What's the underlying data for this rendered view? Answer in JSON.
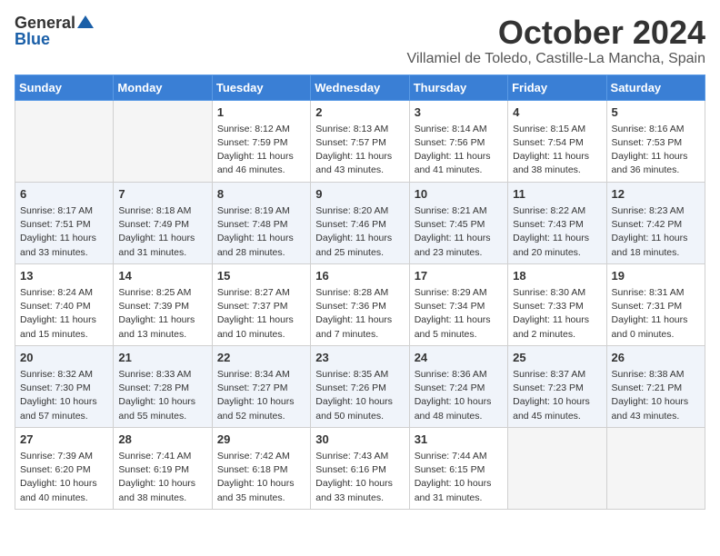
{
  "header": {
    "logo_general": "General",
    "logo_blue": "Blue",
    "month": "October 2024",
    "location": "Villamiel de Toledo, Castille-La Mancha, Spain"
  },
  "days_of_week": [
    "Sunday",
    "Monday",
    "Tuesday",
    "Wednesday",
    "Thursday",
    "Friday",
    "Saturday"
  ],
  "weeks": [
    [
      {
        "day": "",
        "sunrise": "",
        "sunset": "",
        "daylight": "",
        "empty": true
      },
      {
        "day": "",
        "sunrise": "",
        "sunset": "",
        "daylight": "",
        "empty": true
      },
      {
        "day": "1",
        "sunrise": "Sunrise: 8:12 AM",
        "sunset": "Sunset: 7:59 PM",
        "daylight": "Daylight: 11 hours and 46 minutes."
      },
      {
        "day": "2",
        "sunrise": "Sunrise: 8:13 AM",
        "sunset": "Sunset: 7:57 PM",
        "daylight": "Daylight: 11 hours and 43 minutes."
      },
      {
        "day": "3",
        "sunrise": "Sunrise: 8:14 AM",
        "sunset": "Sunset: 7:56 PM",
        "daylight": "Daylight: 11 hours and 41 minutes."
      },
      {
        "day": "4",
        "sunrise": "Sunrise: 8:15 AM",
        "sunset": "Sunset: 7:54 PM",
        "daylight": "Daylight: 11 hours and 38 minutes."
      },
      {
        "day": "5",
        "sunrise": "Sunrise: 8:16 AM",
        "sunset": "Sunset: 7:53 PM",
        "daylight": "Daylight: 11 hours and 36 minutes."
      }
    ],
    [
      {
        "day": "6",
        "sunrise": "Sunrise: 8:17 AM",
        "sunset": "Sunset: 7:51 PM",
        "daylight": "Daylight: 11 hours and 33 minutes."
      },
      {
        "day": "7",
        "sunrise": "Sunrise: 8:18 AM",
        "sunset": "Sunset: 7:49 PM",
        "daylight": "Daylight: 11 hours and 31 minutes."
      },
      {
        "day": "8",
        "sunrise": "Sunrise: 8:19 AM",
        "sunset": "Sunset: 7:48 PM",
        "daylight": "Daylight: 11 hours and 28 minutes."
      },
      {
        "day": "9",
        "sunrise": "Sunrise: 8:20 AM",
        "sunset": "Sunset: 7:46 PM",
        "daylight": "Daylight: 11 hours and 25 minutes."
      },
      {
        "day": "10",
        "sunrise": "Sunrise: 8:21 AM",
        "sunset": "Sunset: 7:45 PM",
        "daylight": "Daylight: 11 hours and 23 minutes."
      },
      {
        "day": "11",
        "sunrise": "Sunrise: 8:22 AM",
        "sunset": "Sunset: 7:43 PM",
        "daylight": "Daylight: 11 hours and 20 minutes."
      },
      {
        "day": "12",
        "sunrise": "Sunrise: 8:23 AM",
        "sunset": "Sunset: 7:42 PM",
        "daylight": "Daylight: 11 hours and 18 minutes."
      }
    ],
    [
      {
        "day": "13",
        "sunrise": "Sunrise: 8:24 AM",
        "sunset": "Sunset: 7:40 PM",
        "daylight": "Daylight: 11 hours and 15 minutes."
      },
      {
        "day": "14",
        "sunrise": "Sunrise: 8:25 AM",
        "sunset": "Sunset: 7:39 PM",
        "daylight": "Daylight: 11 hours and 13 minutes."
      },
      {
        "day": "15",
        "sunrise": "Sunrise: 8:27 AM",
        "sunset": "Sunset: 7:37 PM",
        "daylight": "Daylight: 11 hours and 10 minutes."
      },
      {
        "day": "16",
        "sunrise": "Sunrise: 8:28 AM",
        "sunset": "Sunset: 7:36 PM",
        "daylight": "Daylight: 11 hours and 7 minutes."
      },
      {
        "day": "17",
        "sunrise": "Sunrise: 8:29 AM",
        "sunset": "Sunset: 7:34 PM",
        "daylight": "Daylight: 11 hours and 5 minutes."
      },
      {
        "day": "18",
        "sunrise": "Sunrise: 8:30 AM",
        "sunset": "Sunset: 7:33 PM",
        "daylight": "Daylight: 11 hours and 2 minutes."
      },
      {
        "day": "19",
        "sunrise": "Sunrise: 8:31 AM",
        "sunset": "Sunset: 7:31 PM",
        "daylight": "Daylight: 11 hours and 0 minutes."
      }
    ],
    [
      {
        "day": "20",
        "sunrise": "Sunrise: 8:32 AM",
        "sunset": "Sunset: 7:30 PM",
        "daylight": "Daylight: 10 hours and 57 minutes."
      },
      {
        "day": "21",
        "sunrise": "Sunrise: 8:33 AM",
        "sunset": "Sunset: 7:28 PM",
        "daylight": "Daylight: 10 hours and 55 minutes."
      },
      {
        "day": "22",
        "sunrise": "Sunrise: 8:34 AM",
        "sunset": "Sunset: 7:27 PM",
        "daylight": "Daylight: 10 hours and 52 minutes."
      },
      {
        "day": "23",
        "sunrise": "Sunrise: 8:35 AM",
        "sunset": "Sunset: 7:26 PM",
        "daylight": "Daylight: 10 hours and 50 minutes."
      },
      {
        "day": "24",
        "sunrise": "Sunrise: 8:36 AM",
        "sunset": "Sunset: 7:24 PM",
        "daylight": "Daylight: 10 hours and 48 minutes."
      },
      {
        "day": "25",
        "sunrise": "Sunrise: 8:37 AM",
        "sunset": "Sunset: 7:23 PM",
        "daylight": "Daylight: 10 hours and 45 minutes."
      },
      {
        "day": "26",
        "sunrise": "Sunrise: 8:38 AM",
        "sunset": "Sunset: 7:21 PM",
        "daylight": "Daylight: 10 hours and 43 minutes."
      }
    ],
    [
      {
        "day": "27",
        "sunrise": "Sunrise: 7:39 AM",
        "sunset": "Sunset: 6:20 PM",
        "daylight": "Daylight: 10 hours and 40 minutes."
      },
      {
        "day": "28",
        "sunrise": "Sunrise: 7:41 AM",
        "sunset": "Sunset: 6:19 PM",
        "daylight": "Daylight: 10 hours and 38 minutes."
      },
      {
        "day": "29",
        "sunrise": "Sunrise: 7:42 AM",
        "sunset": "Sunset: 6:18 PM",
        "daylight": "Daylight: 10 hours and 35 minutes."
      },
      {
        "day": "30",
        "sunrise": "Sunrise: 7:43 AM",
        "sunset": "Sunset: 6:16 PM",
        "daylight": "Daylight: 10 hours and 33 minutes."
      },
      {
        "day": "31",
        "sunrise": "Sunrise: 7:44 AM",
        "sunset": "Sunset: 6:15 PM",
        "daylight": "Daylight: 10 hours and 31 minutes."
      },
      {
        "day": "",
        "sunrise": "",
        "sunset": "",
        "daylight": "",
        "empty": true
      },
      {
        "day": "",
        "sunrise": "",
        "sunset": "",
        "daylight": "",
        "empty": true
      }
    ]
  ]
}
